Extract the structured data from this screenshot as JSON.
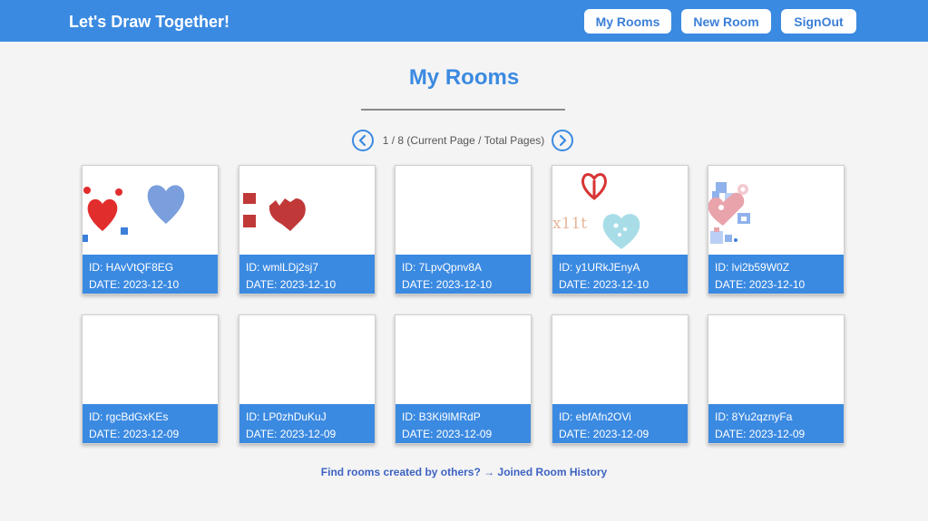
{
  "header": {
    "title": "Let's Draw Together!",
    "nav": {
      "my_rooms": "My Rooms",
      "new_room": "New Room",
      "sign_out": "SignOut"
    }
  },
  "page": {
    "title": "My Rooms",
    "pager": {
      "text": "1 / 8 (Current Page / Total Pages)",
      "prev_icon": "chevron-left-icon",
      "next_icon": "chevron-right-icon"
    }
  },
  "rooms": [
    {
      "id": "ID: HAvVtQF8EG",
      "date": "DATE: 2023-12-10"
    },
    {
      "id": "ID: wmlLDj2sj7",
      "date": "DATE: 2023-12-10"
    },
    {
      "id": "ID: 7LpvQpnv8A",
      "date": "DATE: 2023-12-10"
    },
    {
      "id": "ID: y1URkJEnyA",
      "date": "DATE: 2023-12-10",
      "sketch_text": "x11t"
    },
    {
      "id": "ID: lvi2b59W0Z",
      "date": "DATE: 2023-12-10"
    },
    {
      "id": "ID: rgcBdGxKEs",
      "date": "DATE: 2023-12-09"
    },
    {
      "id": "ID: LP0zhDuKuJ",
      "date": "DATE: 2023-12-09"
    },
    {
      "id": "ID: B3Ki9lMRdP",
      "date": "DATE: 2023-12-09"
    },
    {
      "id": "ID: ebfAfn2OVi",
      "date": "DATE: 2023-12-09"
    },
    {
      "id": "ID: 8Yu2qznyFa",
      "date": "DATE: 2023-12-09"
    }
  ],
  "footer": {
    "prompt": "Find rooms created by others?",
    "arrow": "→",
    "link": "Joined Room History"
  },
  "colors": {
    "header_bg": "#3b8ae1",
    "card_info_bg": "#3b8ae1",
    "accent_text": "#3b8ae1",
    "footer_link": "#3d63c2",
    "page_bg": "#f4f4f4"
  }
}
